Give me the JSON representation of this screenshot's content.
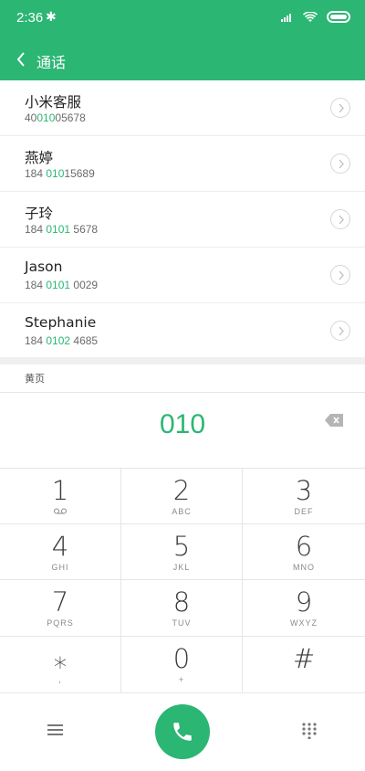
{
  "status": {
    "time": "2:36",
    "bluetooth": "✱"
  },
  "header": {
    "title": "通话"
  },
  "contacts": [
    {
      "name": "小米客服",
      "num_pre": "40",
      "num_hl": "010",
      "num_post": "05678"
    },
    {
      "name": "燕婷",
      "num_pre": "184 ",
      "num_hl": "010",
      "num_post": "15689"
    },
    {
      "name": "子玲",
      "num_pre": "184 ",
      "num_hl": "0101",
      "num_post": " 5678"
    },
    {
      "name": "Jason",
      "num_pre": "184 ",
      "num_hl": "0101",
      "num_post": " 0029"
    },
    {
      "name": "Stephanie",
      "num_pre": "184 ",
      "num_hl": "0102",
      "num_post": " 4685"
    }
  ],
  "yellow_pages": "黄页",
  "dialed": "010",
  "keys": [
    {
      "digit": "1",
      "letters": ""
    },
    {
      "digit": "2",
      "letters": "ABC"
    },
    {
      "digit": "3",
      "letters": "DEF"
    },
    {
      "digit": "4",
      "letters": "GHI"
    },
    {
      "digit": "5",
      "letters": "JKL"
    },
    {
      "digit": "6",
      "letters": "MNO"
    },
    {
      "digit": "7",
      "letters": "PQRS"
    },
    {
      "digit": "8",
      "letters": "TUV"
    },
    {
      "digit": "9",
      "letters": "WXYZ"
    },
    {
      "digit": "⁎",
      "letters": ","
    },
    {
      "digit": "0",
      "letters": "+"
    },
    {
      "digit": "#",
      "letters": ""
    }
  ],
  "colors": {
    "accent": "#2bb673"
  },
  "icons": {
    "back": "chevron-left-icon",
    "delete": "backspace-icon",
    "call": "phone-icon",
    "menu": "menu-icon",
    "keypad": "dialpad-icon"
  }
}
